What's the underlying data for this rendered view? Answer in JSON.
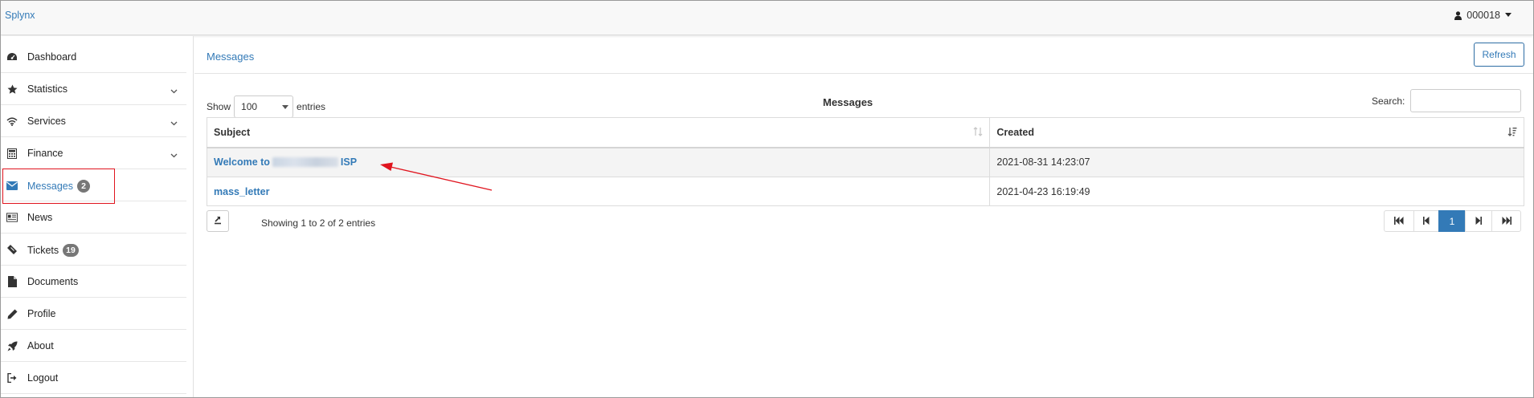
{
  "app": {
    "brand": "Splynx",
    "user": "000018"
  },
  "sidebar": {
    "items": [
      {
        "label": "Dashboard",
        "icon": "dashboard-icon"
      },
      {
        "label": "Statistics",
        "icon": "star-icon",
        "has_children": true
      },
      {
        "label": "Services",
        "icon": "wifi-icon",
        "has_children": true
      },
      {
        "label": "Finance",
        "icon": "calculator-icon",
        "has_children": true
      },
      {
        "label": "Messages",
        "icon": "envelope-icon",
        "badge": "2",
        "active": true
      },
      {
        "label": "News",
        "icon": "newspaper-icon"
      },
      {
        "label": "Tickets",
        "icon": "ticket-icon",
        "badge": "19"
      },
      {
        "label": "Documents",
        "icon": "file-icon"
      },
      {
        "label": "Profile",
        "icon": "pencil-icon"
      },
      {
        "label": "About",
        "icon": "rocket-icon"
      },
      {
        "label": "Logout",
        "icon": "sign-out-icon"
      }
    ]
  },
  "page": {
    "title": "Messages",
    "refresh_label": "Refresh",
    "show_label": "Show",
    "entries_label": "entries",
    "page_length": "100",
    "table_caption": "Messages",
    "search_label": "Search:",
    "search_value": "",
    "columns": [
      "Subject",
      "Created"
    ],
    "rows": [
      {
        "subject_prefix": "Welcome to",
        "subject_suffix": "ISP",
        "created": "2021-08-31 14:23:07"
      },
      {
        "subject": "mass_letter",
        "created": "2021-04-23 16:19:49"
      }
    ],
    "info": "Showing 1 to 2 of 2 entries",
    "pagination": {
      "current": "1"
    }
  },
  "colors": {
    "accent": "#337ab7",
    "annotation": "#e0141e",
    "badge": "#777777"
  }
}
